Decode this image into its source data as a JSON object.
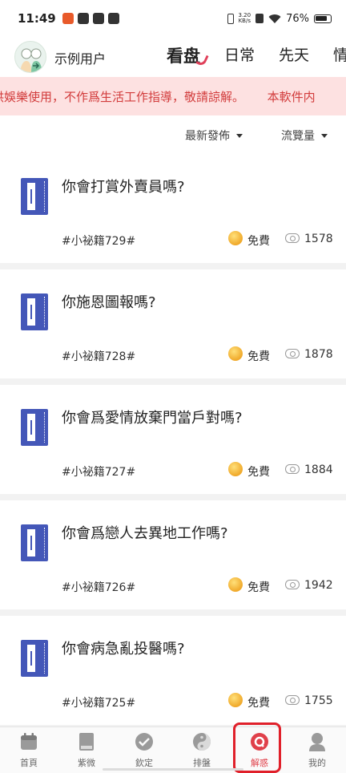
{
  "status_bar": {
    "time": "11:49",
    "net_speed_value": "3.20",
    "net_speed_unit": "KB/s",
    "battery": "76%"
  },
  "header": {
    "username": "示例用户",
    "tabs": [
      {
        "label": "看盘",
        "active": true
      },
      {
        "label": "日常",
        "active": false
      },
      {
        "label": "先天",
        "active": false
      },
      {
        "label": "情",
        "active": false
      }
    ]
  },
  "notice": {
    "text": "供娛樂使用，不作爲生活工作指導，敬請諒解。      本軟件内"
  },
  "filters": {
    "sort_label": "最新發佈",
    "views_label": "流覽量"
  },
  "cards": [
    {
      "title": "你會打賞外賣員嗎?",
      "tag": "#小祕籍729#",
      "price": "免費",
      "views": "1578"
    },
    {
      "title": "你施恩圖報嗎?",
      "tag": "#小祕籍728#",
      "price": "免費",
      "views": "1878"
    },
    {
      "title": "你會爲愛情放棄門當戶對嗎?",
      "tag": "#小祕籍727#",
      "price": "免費",
      "views": "1884"
    },
    {
      "title": "你會爲戀人去異地工作嗎?",
      "tag": "#小祕籍726#",
      "price": "免費",
      "views": "1942"
    },
    {
      "title": "你會病急亂投醫嗎?",
      "tag": "#小祕籍725#",
      "price": "免費",
      "views": "1755"
    }
  ],
  "bottom_nav": [
    {
      "label": "首頁",
      "icon": "calendar-icon"
    },
    {
      "label": "紫微",
      "icon": "book-icon"
    },
    {
      "label": "欽定",
      "icon": "seal-check-icon"
    },
    {
      "label": "排盤",
      "icon": "yin-yang-icon"
    },
    {
      "label": "解惑",
      "icon": "chat-bubble-icon",
      "active": true
    },
    {
      "label": "我的",
      "icon": "user-icon"
    }
  ],
  "colors": {
    "accent": "#e0404a",
    "notice_bg": "#fde1e1",
    "notice_text": "#d23c3c",
    "book_blue": "#4457b8"
  }
}
